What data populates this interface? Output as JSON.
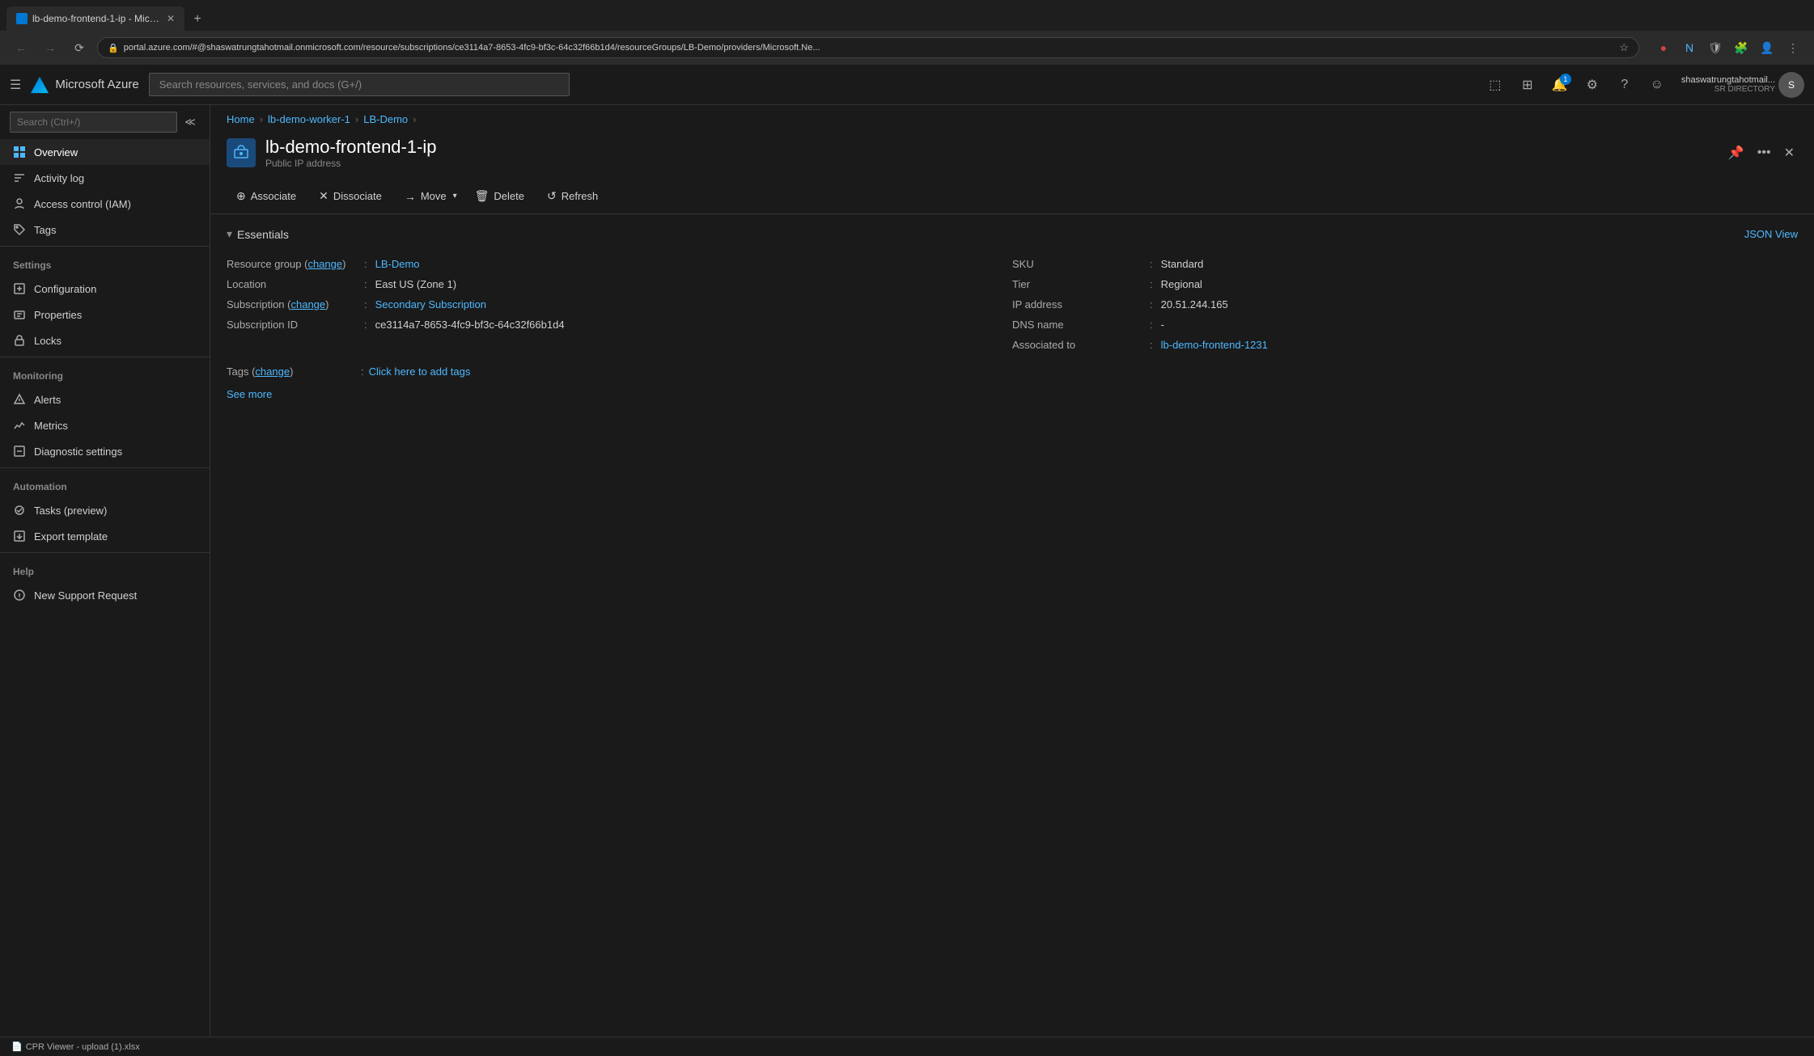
{
  "browser": {
    "tab_title": "lb-demo-frontend-1-ip - Micros...",
    "address_bar": "portal.azure.com/#@shaswatrungtahotmail.onmicrosoft.com/resource/subscriptions/ce3114a7-8653-4fc9-bf3c-64c32f66b1d4/resourceGroups/LB-Demo/providers/Microsoft.Ne...",
    "new_tab_label": "+"
  },
  "azure_header": {
    "logo_text": "Microsoft Azure",
    "search_placeholder": "Search resources, services, and docs (G+/)",
    "account_name": "shaswatrungtahotmail...",
    "account_dir": "SR DIRECTORY"
  },
  "breadcrumb": {
    "home": "Home",
    "worker": "lb-demo-worker-1",
    "demo": "LB-Demo"
  },
  "resource": {
    "title": "lb-demo-frontend-1-ip",
    "subtitle": "Public IP address"
  },
  "toolbar": {
    "associate_label": "Associate",
    "dissociate_label": "Dissociate",
    "move_label": "Move",
    "delete_label": "Delete",
    "refresh_label": "Refresh"
  },
  "essentials": {
    "title": "Essentials",
    "json_view": "JSON View",
    "fields_left": [
      {
        "label": "Resource group",
        "change_link": "change",
        "value": "LB-Demo",
        "is_link": true
      },
      {
        "label": "Location",
        "value": "East US (Zone 1)",
        "is_link": false
      },
      {
        "label": "Subscription",
        "change_link": "change",
        "value": "Secondary Subscription",
        "is_link": true
      },
      {
        "label": "Subscription ID",
        "value": "ce3114a7-8653-4fc9-bf3c-64c32f66b1d4",
        "is_link": false
      }
    ],
    "fields_right": [
      {
        "label": "SKU",
        "value": "Standard",
        "is_link": false
      },
      {
        "label": "Tier",
        "value": "Regional",
        "is_link": false
      },
      {
        "label": "IP address",
        "value": "20.51.244.165",
        "is_link": false
      },
      {
        "label": "DNS name",
        "value": "-",
        "is_link": false
      },
      {
        "label": "Associated to",
        "value": "lb-demo-frontend-1231",
        "is_link": true
      }
    ],
    "tags_label": "Tags",
    "tags_change": "change",
    "tags_value": "Click here to add tags",
    "see_more": "See more"
  },
  "sidebar": {
    "search_placeholder": "Search (Ctrl+/)",
    "items_top": [
      {
        "id": "overview",
        "label": "Overview",
        "active": true
      },
      {
        "id": "activity-log",
        "label": "Activity log",
        "active": false
      },
      {
        "id": "access-control",
        "label": "Access control (IAM)",
        "active": false
      },
      {
        "id": "tags",
        "label": "Tags",
        "active": false
      }
    ],
    "section_settings": "Settings",
    "items_settings": [
      {
        "id": "configuration",
        "label": "Configuration",
        "active": false
      },
      {
        "id": "properties",
        "label": "Properties",
        "active": false
      },
      {
        "id": "locks",
        "label": "Locks",
        "active": false
      }
    ],
    "section_monitoring": "Monitoring",
    "items_monitoring": [
      {
        "id": "alerts",
        "label": "Alerts",
        "active": false
      },
      {
        "id": "metrics",
        "label": "Metrics",
        "active": false
      },
      {
        "id": "diagnostic-settings",
        "label": "Diagnostic settings",
        "active": false
      }
    ],
    "section_automation": "Automation",
    "items_automation": [
      {
        "id": "tasks-preview",
        "label": "Tasks (preview)",
        "active": false
      },
      {
        "id": "export-template",
        "label": "Export template",
        "active": false
      }
    ],
    "section_help": "Help",
    "items_help": [
      {
        "id": "new-support-request",
        "label": "New Support Request",
        "active": false
      }
    ]
  },
  "bottom_bar": {
    "item": "CPR Viewer - upload (1).xlsx"
  }
}
